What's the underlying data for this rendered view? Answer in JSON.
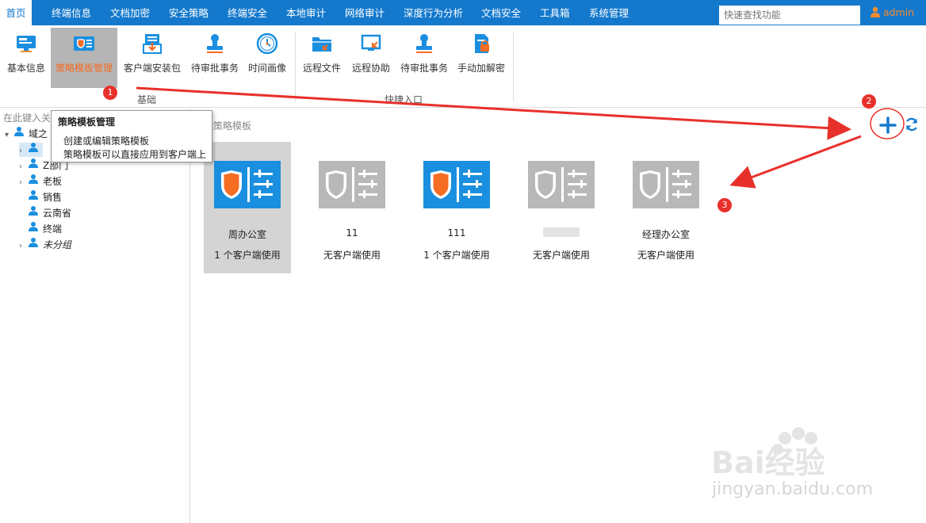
{
  "nav": {
    "tabs": [
      "首页",
      "终端信息",
      "文档加密",
      "安全策略",
      "终端安全",
      "本地审计",
      "网络审计",
      "深度行为分析",
      "文档安全",
      "工具箱",
      "系统管理"
    ],
    "active_index": 0,
    "search_placeholder": "快速查找功能",
    "user": "admin",
    "color": "#1479cc"
  },
  "ribbon": {
    "tools": [
      {
        "label": "基本信息",
        "icon": "monitor-icon"
      },
      {
        "label": "策略模板管理",
        "icon": "policy-template-icon",
        "selected": true
      },
      {
        "label": "客户端安装包",
        "icon": "install-package-icon"
      },
      {
        "label": "待审批事务",
        "icon": "approval-stamp-icon"
      },
      {
        "label": "时间画像",
        "icon": "clock-icon"
      },
      {
        "label": "远程文件",
        "icon": "remote-folder-icon"
      },
      {
        "label": "远程协助",
        "icon": "remote-assist-icon"
      },
      {
        "label": "待审批事务",
        "icon": "approval-stamp-icon"
      },
      {
        "label": "手动加解密",
        "icon": "manual-encrypt-icon"
      }
    ],
    "groups": [
      "基础",
      "快捷入口"
    ]
  },
  "tree": {
    "search_placeholder": "在此键入关",
    "items": [
      {
        "label": "域之"
      },
      {
        "label": ""
      },
      {
        "label": "Z部门"
      },
      {
        "label": "老板"
      },
      {
        "label": "销售"
      },
      {
        "label": "云南省"
      },
      {
        "label": "终端"
      },
      {
        "label": "未分组"
      }
    ]
  },
  "tooltip": {
    "title": "策略模板管理",
    "lines": [
      "创建或编辑策略模板",
      "策略模板可以直接应用到客户端上"
    ]
  },
  "main": {
    "title": "理策略模板",
    "templates": [
      {
        "name": "周办公室",
        "usage": "1 个客户端使用",
        "active": true
      },
      {
        "name": "11",
        "usage": "无客户端使用",
        "active": false
      },
      {
        "name": "111",
        "usage": "1 个客户端使用",
        "active": true
      },
      {
        "name": "",
        "usage": "无客户端使用",
        "active": false
      },
      {
        "name": "经理办公室",
        "usage": "无客户端使用",
        "active": false
      }
    ]
  },
  "annotations": {
    "badges": [
      "1",
      "2",
      "3"
    ],
    "arrow_color": "#e8302b"
  },
  "watermark": {
    "brand": "Bai经验",
    "url": "jingyan.baidu.com"
  }
}
